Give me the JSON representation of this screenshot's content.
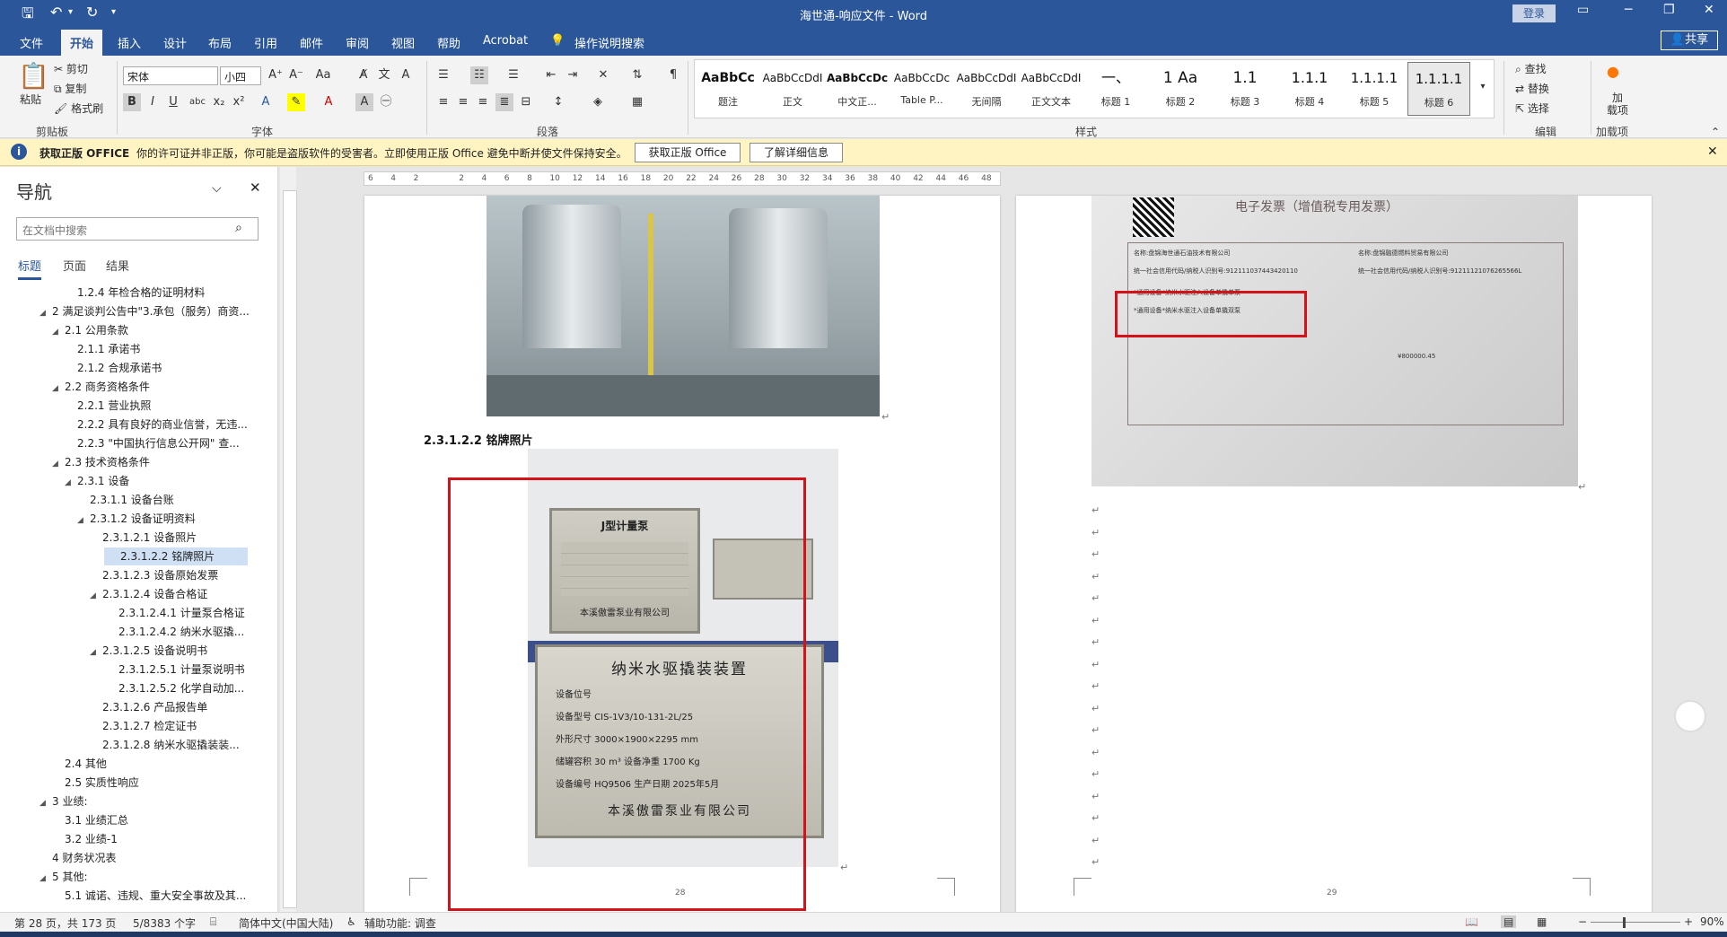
{
  "app": {
    "title": "海世通-响应文件 - Word",
    "login": "登录",
    "share": "共享"
  },
  "tabs": [
    "文件",
    "开始",
    "插入",
    "设计",
    "布局",
    "引用",
    "邮件",
    "审阅",
    "视图",
    "帮助",
    "Acrobat",
    "操作说明搜索"
  ],
  "active_tab": "开始",
  "ribbon": {
    "clipboard": {
      "paste": "粘贴",
      "cut": "剪切",
      "copy": "复制",
      "format_painter": "格式刷",
      "label": "剪贴板"
    },
    "font": {
      "name": "宋体",
      "size": "小四",
      "label": "字体"
    },
    "paragraph": {
      "label": "段落"
    },
    "styles": {
      "label": "样式",
      "items": [
        {
          "preview": "AaBbCc",
          "name": "题注"
        },
        {
          "preview": "AaBbCcDdI",
          "name": "正文"
        },
        {
          "preview": "AaBbCcDc",
          "name": "中文正..."
        },
        {
          "preview": "AaBbCcDc",
          "name": "Table P..."
        },
        {
          "preview": "AaBbCcDdI",
          "name": "无间隔"
        },
        {
          "preview": "AaBbCcDdI",
          "name": "正文文本"
        },
        {
          "preview": "一、",
          "name": "标题 1"
        },
        {
          "preview": "1 Aa",
          "name": "标题 2"
        },
        {
          "preview": "1.1",
          "name": "标题 3"
        },
        {
          "preview": "1.1.1",
          "name": "标题 4"
        },
        {
          "preview": "1.1.1.1",
          "name": "标题 5"
        },
        {
          "preview": "1.1.1.1",
          "name": "标题 6"
        }
      ]
    },
    "editing": {
      "find": "查找",
      "replace": "替换",
      "select": "选择",
      "label": "编辑"
    },
    "addins": {
      "label": "加载项",
      "btn1": "加",
      "btn2": "载项"
    }
  },
  "msgbar": {
    "title": "获取正版 OFFICE",
    "text": "你的许可证并非正版，你可能是盗版软件的受害者。立即使用正版 Office 避免中断并使文件保持安全。",
    "btn1": "获取正版 Office",
    "btn2": "了解详细信息"
  },
  "nav": {
    "title": "导航",
    "search_placeholder": "在文档中搜索",
    "tabs": [
      "标题",
      "页面",
      "结果"
    ],
    "items": [
      {
        "text": "1.2.4 年检合格的证明材料",
        "level": 3,
        "caret": ""
      },
      {
        "text": "2 满足谈判公告中\"3.承包（服务）商资...",
        "level": 1,
        "caret": "◢"
      },
      {
        "text": "2.1 公用条款",
        "level": 2,
        "caret": "◢"
      },
      {
        "text": "2.1.1 承诺书",
        "level": 3,
        "caret": ""
      },
      {
        "text": "2.1.2 合规承诺书",
        "level": 3,
        "caret": ""
      },
      {
        "text": "2.2 商务资格条件",
        "level": 2,
        "caret": "◢"
      },
      {
        "text": "2.2.1 营业执照",
        "level": 3,
        "caret": ""
      },
      {
        "text": "2.2.2 具有良好的商业信誉，无违...",
        "level": 3,
        "caret": ""
      },
      {
        "text": "2.2.3 \"中国执行信息公开网\" 查...",
        "level": 3,
        "caret": ""
      },
      {
        "text": "2.3 技术资格条件",
        "level": 2,
        "caret": "◢"
      },
      {
        "text": "2.3.1 设备",
        "level": 3,
        "caret": "◢"
      },
      {
        "text": "2.3.1.1 设备台账",
        "level": 4,
        "caret": ""
      },
      {
        "text": "2.3.1.2 设备证明资料",
        "level": 4,
        "caret": "◢"
      },
      {
        "text": "2.3.1.2.1 设备照片",
        "level": 5,
        "caret": ""
      },
      {
        "text": "2.3.1.2.2 铭牌照片",
        "level": 5,
        "caret": "",
        "selected": true
      },
      {
        "text": "2.3.1.2.3 设备原始发票",
        "level": 5,
        "caret": ""
      },
      {
        "text": "2.3.1.2.4 设备合格证",
        "level": 5,
        "caret": "◢"
      },
      {
        "text": "2.3.1.2.4.1 计量泵合格证",
        "level": 6,
        "caret": ""
      },
      {
        "text": "2.3.1.2.4.2 纳米水驱撬...",
        "level": 6,
        "caret": ""
      },
      {
        "text": "2.3.1.2.5 设备说明书",
        "level": 5,
        "caret": "◢"
      },
      {
        "text": "2.3.1.2.5.1 计量泵说明书",
        "level": 6,
        "caret": ""
      },
      {
        "text": "2.3.1.2.5.2 化学自动加...",
        "level": 6,
        "caret": ""
      },
      {
        "text": "2.3.1.2.6 产品报告单",
        "level": 5,
        "caret": ""
      },
      {
        "text": "2.3.1.2.7 检定证书",
        "level": 5,
        "caret": ""
      },
      {
        "text": "2.3.1.2.8 纳米水驱撬装装...",
        "level": 5,
        "caret": ""
      },
      {
        "text": "2.4 其他",
        "level": 2,
        "caret": ""
      },
      {
        "text": "2.5 实质性响应",
        "level": 2,
        "caret": ""
      },
      {
        "text": "3 业绩:",
        "level": 1,
        "caret": "◢"
      },
      {
        "text": "3.1 业绩汇总",
        "level": 2,
        "caret": ""
      },
      {
        "text": "3.2 业绩-1",
        "level": 2,
        "caret": ""
      },
      {
        "text": "4 财务状况表",
        "level": 1,
        "caret": ""
      },
      {
        "text": "5 其他:",
        "level": 1,
        "caret": "◢"
      },
      {
        "text": "5.1 诚诺、违规、重大安全事故及其...",
        "level": 2,
        "caret": ""
      }
    ]
  },
  "ruler": [
    "6",
    "4",
    "2",
    "",
    "2",
    "4",
    "6",
    "8",
    "10",
    "12",
    "14",
    "16",
    "18",
    "20",
    "22",
    "24",
    "26",
    "28",
    "30",
    "32",
    "34",
    "36",
    "38",
    "40",
    "42",
    "44",
    "46",
    "48"
  ],
  "document": {
    "heading": "2.3.1.2.2  铭牌照片",
    "page_left": "28",
    "page_right": "29",
    "invoice_title": "电子发票（增值税专用发票）",
    "invoice_seller": "名称:盘锦海世通石油技术有限公司",
    "invoice_buyer": "名称:盘锦融德燃料贸易有限公司",
    "invoice_tax1": "统一社会信用代码/纳税人识别号:912111037443420110",
    "invoice_tax2": "统一社会信用代码/纳税人识别号:91211121076265566L",
    "invoice_item1": "*通用设备*纳米水驱注入设备单撬单泵",
    "invoice_item2": "*通用设备*纳米水驱注入设备单撬双泵",
    "invoice_total": "¥800000.45",
    "nameplate1_title": "J型计量泵",
    "nameplate1_company": "本溪傲雷泵业有限公司",
    "nameplate2_title": "纳米水驱撬装装置",
    "nameplate2_rows": [
      "设备位号",
      "设备型号 CIS-1V3/10-131-2L/25",
      "外形尺寸 3000×1900×2295 mm",
      "储罐容积 30 m³  设备净重 1700 Kg",
      "设备编号 HQ9506  生产日期 2025年5月"
    ],
    "nameplate2_company": "本溪傲雷泵业有限公司"
  },
  "status": {
    "page": "第 28 页，共 173 页",
    "words": "5/8383 个字",
    "lang": "简体中文(中国大陆)",
    "access": "辅助功能: 调查",
    "zoom": "90%"
  }
}
